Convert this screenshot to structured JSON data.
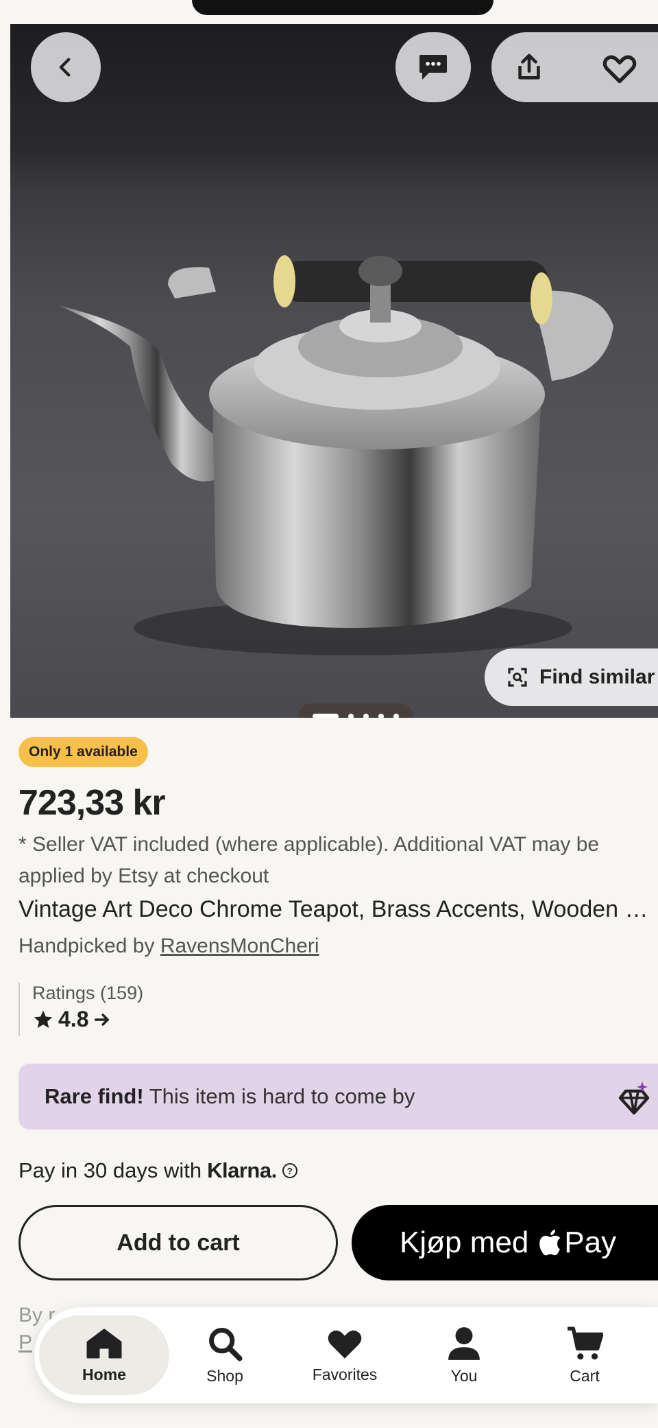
{
  "product": {
    "availability_badge": "Only 1 available",
    "price": "723,33 kr",
    "vat_note": "* Seller VAT included (where applicable). Additional VAT may be applied by Etsy at checkout",
    "title": "Vintage Art Deco Chrome Teapot, Brass Accents, Wooden Handle",
    "handpicked_prefix": "Handpicked by",
    "shop_name": "RavensMonCheri",
    "ratings_label": "Ratings (159)",
    "rating_value": "4.8"
  },
  "image": {
    "find_similar_label": "Find similar",
    "page_count": 5,
    "current_page": 1
  },
  "top_actions": {
    "back_icon": "chevron-left-icon",
    "message_icon": "message-icon",
    "share_icon": "share-icon",
    "favorite_icon": "heart-icon"
  },
  "rare_find": {
    "bold": "Rare find!",
    "text": "This item is hard to come by"
  },
  "klarna": {
    "prefix": "Pay in 30 days with",
    "brand": "Klarna."
  },
  "buttons": {
    "add_to_cart": "Add to cart",
    "apple_pay_prefix": "Kjøp med",
    "apple_pay_brand": "Pay"
  },
  "partial_text": {
    "line1": "By r",
    "line2": "P"
  },
  "nav": {
    "items": [
      {
        "label": "Home",
        "icon": "home-icon"
      },
      {
        "label": "Shop",
        "icon": "search-icon"
      },
      {
        "label": "Favorites",
        "icon": "heart-icon"
      },
      {
        "label": "You",
        "icon": "person-icon"
      },
      {
        "label": "Cart",
        "icon": "cart-icon"
      }
    ]
  },
  "colors": {
    "badge": "#f7c04b",
    "rare_bg": "#e1d3e8",
    "background": "#f7f6f3"
  }
}
